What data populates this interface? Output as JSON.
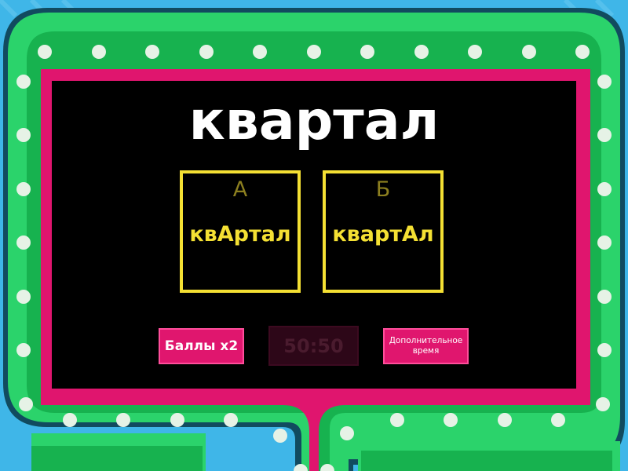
{
  "question": {
    "text": "квартал"
  },
  "answers": [
    {
      "letter": "А",
      "text": "квАртал"
    },
    {
      "letter": "Б",
      "text": "квартАл"
    }
  ],
  "powerups": {
    "double_points": "Баллы x2",
    "fifty_fifty": "50:50",
    "extra_time": "Дополнительное время"
  },
  "colors": {
    "background": "#3fb6e8",
    "frame_green": "#2bd36b",
    "frame_inner_green": "#17b24f",
    "frame_dark": "#114b5f",
    "pink_border": "#e0156e",
    "screen": "#000000",
    "answer_border": "#f4e033",
    "bulb": "#e6f2e6"
  }
}
